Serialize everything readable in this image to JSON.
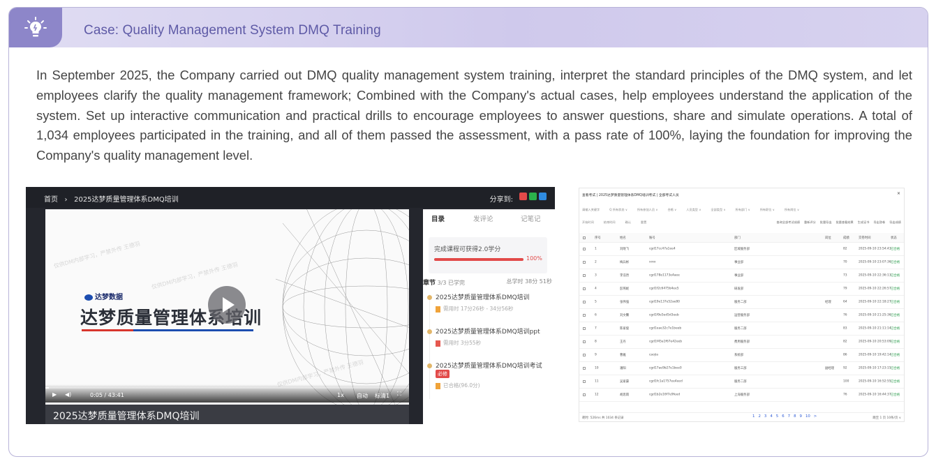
{
  "case": {
    "title": "Case: Quality Management System DMQ Training",
    "body": "In September 2025, the Company carried out DMQ quality management system training, interpret the standard principles of the DMQ system, and let employees clarify the quality management framework; Combined with the Company's actual cases, help employees understand the application of the system. Set up interactive communication and practical drills to encourage employees to answer questions, share and simulate operations. A total of 1,034 employees participated in the training, and all of them passed the assessment, with a pass rate of 100%, laying the foundation for improving the Company's quality management level.",
    "icon": "lightbulb-icon"
  },
  "video_player": {
    "breadcrumb_home": "首页",
    "breadcrumb_sep": "›",
    "breadcrumb_course": "2025达梦质量管理体系DMQ培训",
    "share_label": "分享到:",
    "logo_text": "达梦数据",
    "slide_title": "达梦质量管理体系培训",
    "time": "0:05 / 43:41",
    "speed": "1x",
    "auto": "自动",
    "quality": "标清1",
    "caption": "2025达梦质量管理体系DMQ培训",
    "progress": 0.002,
    "watermark": "仅供DM内部学习，严禁外传 王德羽",
    "tabs": [
      {
        "label": "目录",
        "active": true
      },
      {
        "label": "发评论",
        "active": false
      },
      {
        "label": "记笔记",
        "active": false
      }
    ],
    "completion_label": "完成课程可获得2.0学分",
    "completion_pct_text": "100%",
    "completion_pct": 1.0,
    "chapter_label": "章节",
    "chapter_done": "3/3 已学完",
    "chapter_time": "总学时 38分 51秒",
    "lessons": [
      {
        "title": "2025达梦质量管理体系DMQ培训",
        "sub": "需用时 17分26秒 - 34分56秒",
        "doc": "orange"
      },
      {
        "title": "2025达梦质量管理体系DMQ培训ppt",
        "sub": "需用时 3分55秒",
        "doc": "red"
      },
      {
        "title": "2025达梦质量管理体系DMQ培训考试",
        "sub": "已合格(96.0分)",
        "doc": "orange",
        "tag": "必修"
      }
    ],
    "colors": {
      "accent": "#e24a49",
      "brand_blue": "#1c4db0"
    }
  },
  "table_shot": {
    "title": "查看考试 | 2025达梦质量管理体系DMQ培训考试 | 全部考试人员",
    "close": "×",
    "filters_row1": [
      "请输入关键字",
      "Q 所有状态 ∨",
      "所有参加人员 ∨",
      "合格 ∨",
      "人员类型 ∨",
      "全部类型 ∨",
      "所有部门 ∨",
      "所有职位 ∨",
      "所有岗位 ∨"
    ],
    "filters_row2": [
      "开始时间",
      "结束时间",
      "确认",
      "重置"
    ],
    "actions": [
      "查询全部考试成绩",
      "重新评分",
      "批量导出",
      "批量查看结果",
      "生成证书",
      "导出答卷",
      "导出成绩"
    ],
    "headers": [
      "序号",
      "姓名",
      "账号",
      "部门",
      "岗位",
      "成绩",
      "交卷时间",
      "状态"
    ],
    "rows": [
      {
        "no": "1",
        "name": "刘晓飞",
        "acct": "cgd17cc47a1ee4",
        "dept": "区域服务部",
        "post": "",
        "score": "82",
        "time": "2025-09-10 23:54:43",
        "status": "已合格"
      },
      {
        "no": "2",
        "name": "梅兵彬",
        "acct": "xrxx",
        "dept": "事业部",
        "post": "",
        "score": "70",
        "time": "2025-09-10 23:07:36",
        "status": "已合格"
      },
      {
        "no": "3",
        "name": "李浩然",
        "acct": "cgd178e1173e4aee",
        "dept": "事业部",
        "post": "",
        "score": "73",
        "time": "2025-09-10 22:36:13",
        "status": "已合格"
      },
      {
        "no": "4",
        "name": "彭燕妮",
        "acct": "cgd1f2c6475b4ee5",
        "dept": "研发部",
        "post": "",
        "score": "79",
        "time": "2025-09-10 22:26:57",
        "status": "已合格"
      },
      {
        "no": "5",
        "name": "张伟强",
        "acct": "cgd19e137e52ae80",
        "dept": "服务二部",
        "post": "经理",
        "score": "64",
        "time": "2025-09-10 22:18:27",
        "status": "已合格"
      },
      {
        "no": "6",
        "name": "刘文馨",
        "acct": "cgd1f9e5ed5d3eeb",
        "dept": "运营服务部",
        "post": "",
        "score": "76",
        "time": "2025-09-10 21:25:36",
        "status": "已合格"
      },
      {
        "no": "7",
        "name": "陈家俊",
        "acct": "cgd1eae32c7e1beeb",
        "dept": "服务二部",
        "post": "",
        "score": "83",
        "time": "2025-09-10 21:11:14",
        "status": "已合格"
      },
      {
        "no": "8",
        "name": "王丹",
        "acct": "cgd1f45a1f67e42eeb",
        "dept": "费用服务部",
        "post": "",
        "score": "82",
        "time": "2025-09-10 20:53:09",
        "status": "已合格"
      },
      {
        "no": "9",
        "name": "曹雅",
        "acct": "caojia",
        "dept": "系统部",
        "post": "",
        "score": "86",
        "time": "2025-09-10 19:42:14",
        "status": "已合格"
      },
      {
        "no": "10",
        "name": "潘阳",
        "acct": "cgd17ae9b27e1bee0",
        "dept": "服务三部",
        "post": "副经理",
        "score": "92",
        "time": "2025-09-10 17:23:15",
        "status": "已合格"
      },
      {
        "no": "11",
        "name": "吴家豪",
        "acct": "cgd1fc1a1757ee4eed",
        "dept": "服务二部",
        "post": "",
        "score": "100",
        "time": "2025-09-10 16:52:55",
        "status": "已合格"
      },
      {
        "no": "12",
        "name": "胡思雨",
        "acct": "cgd1b2e16f7e9feed",
        "dept": "上海服务部",
        "post": "",
        "score": "76",
        "time": "2025-09-10 16:44:37",
        "status": "已合格"
      }
    ],
    "footer_left": "耗时: 526ms  共 1034 条记录",
    "pages": [
      "1",
      "2",
      "3",
      "4",
      "5",
      "6",
      "7",
      "8",
      "9",
      "10",
      ">"
    ],
    "footer_right": "跳至 1 页  10条/页 ∨"
  }
}
